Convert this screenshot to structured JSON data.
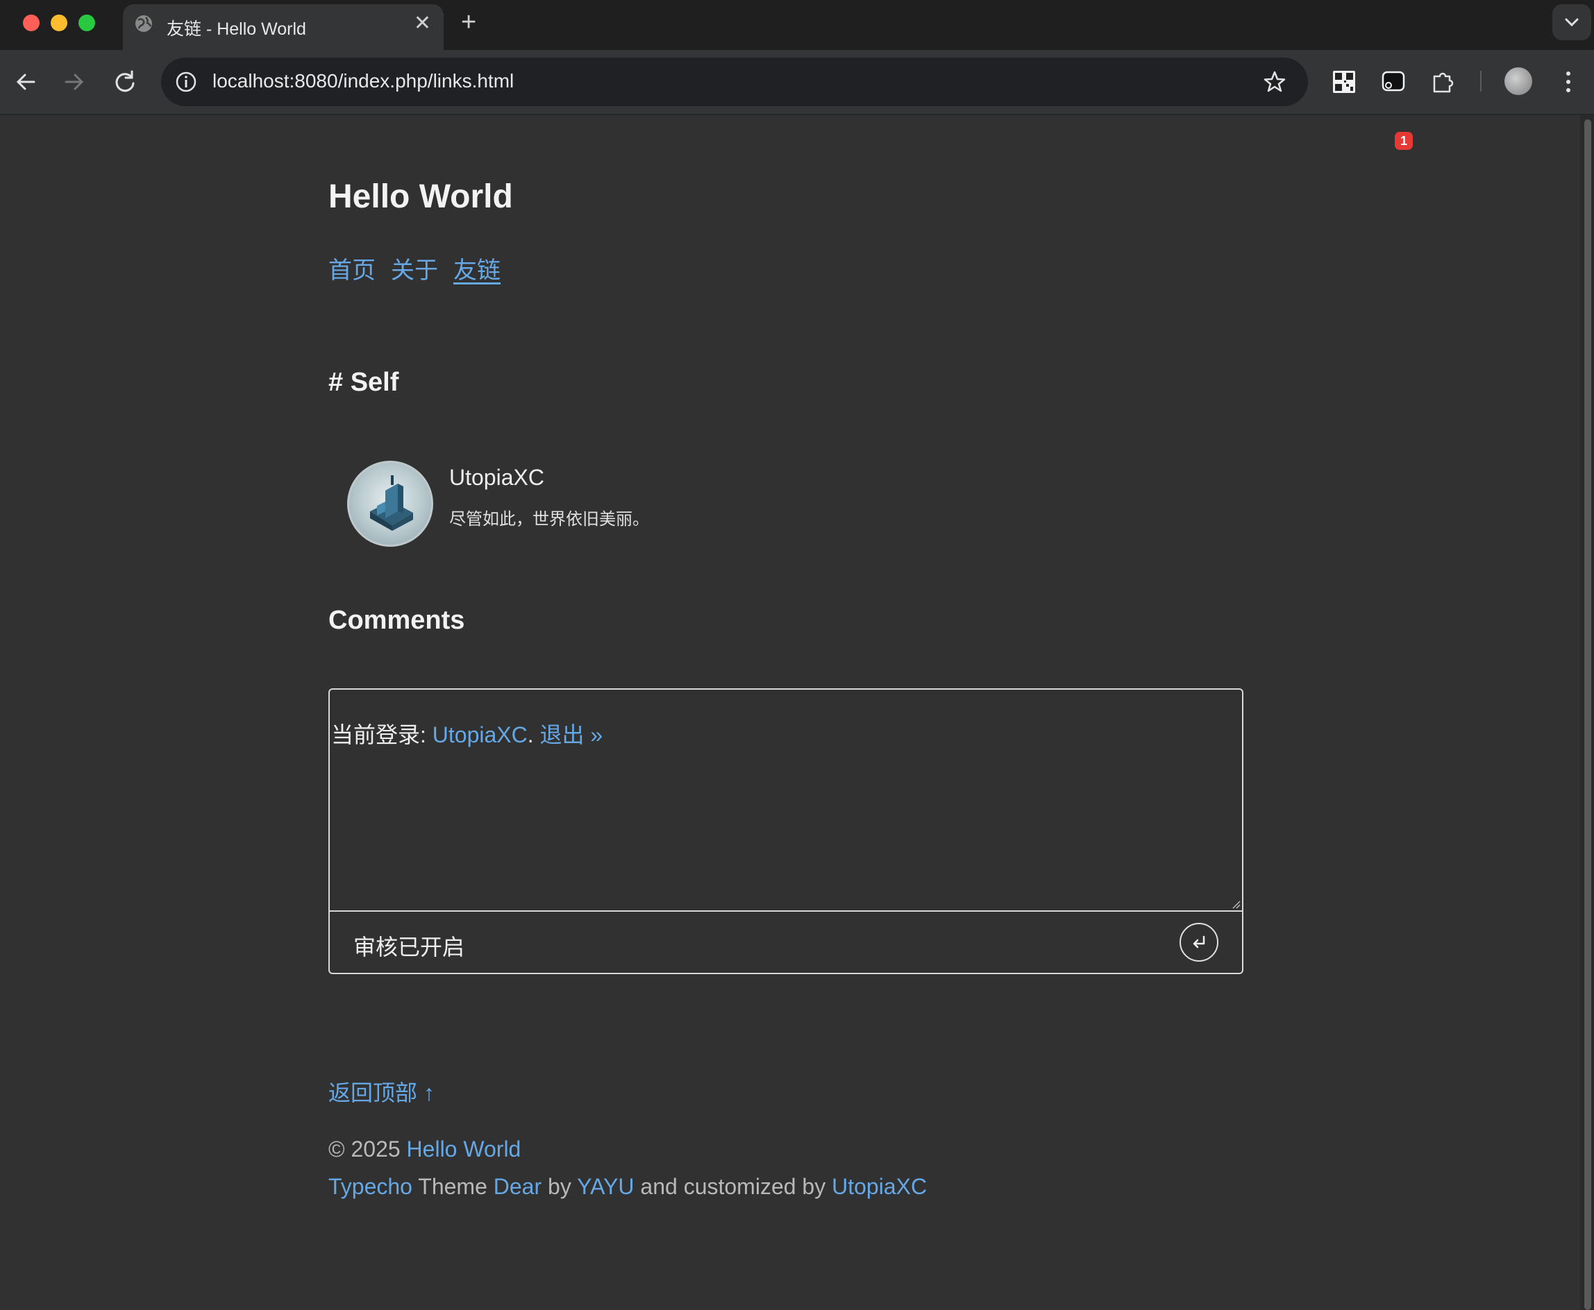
{
  "browser": {
    "tab_title": "友链 - Hello World",
    "tab_close": "✕",
    "new_tab": "+",
    "url": "localhost:8080/index.php/links.html",
    "extension_badge": "1"
  },
  "site": {
    "title": "Hello World",
    "nav": [
      "首页",
      "关于",
      "友链"
    ],
    "current_nav": "友链"
  },
  "links_section": {
    "heading": "# Self",
    "friend": {
      "name": "UtopiaXC",
      "description": "尽管如此，世界依旧美丽。"
    }
  },
  "comments": {
    "heading": "Comments",
    "logged_in_prefix": "当前登录: ",
    "user": "UtopiaXC",
    "separator": ".",
    "logout": "退出 »",
    "moderation": "审核已开启",
    "submit_icon": "↵"
  },
  "footer": {
    "back_to_top": "返回顶部 ↑",
    "copyright_prefix": "© 2025 ",
    "copyright_site": "Hello World",
    "credit_typecho": "Typecho",
    "credit_theme_word": " Theme ",
    "credit_theme": "Dear",
    "credit_by": " by ",
    "credit_author": "YAYU",
    "credit_customized": " and customized by ",
    "credit_customizer": "UtopiaXC"
  },
  "colors": {
    "page_bg": "#313131",
    "link": "#66a8e5",
    "chrome_bg": "#1f1f1f",
    "toolbar_bg": "#333537"
  },
  "icons": [
    "globe-icon",
    "close-icon",
    "plus-icon",
    "chevron-down-icon",
    "back-arrow-icon",
    "forward-arrow-icon",
    "reload-icon",
    "info-icon",
    "star-icon",
    "qr-code-icon",
    "screenshot-extension-icon",
    "puzzle-extension-icon",
    "avatar-icon",
    "kebab-menu-icon",
    "enter-icon"
  ]
}
